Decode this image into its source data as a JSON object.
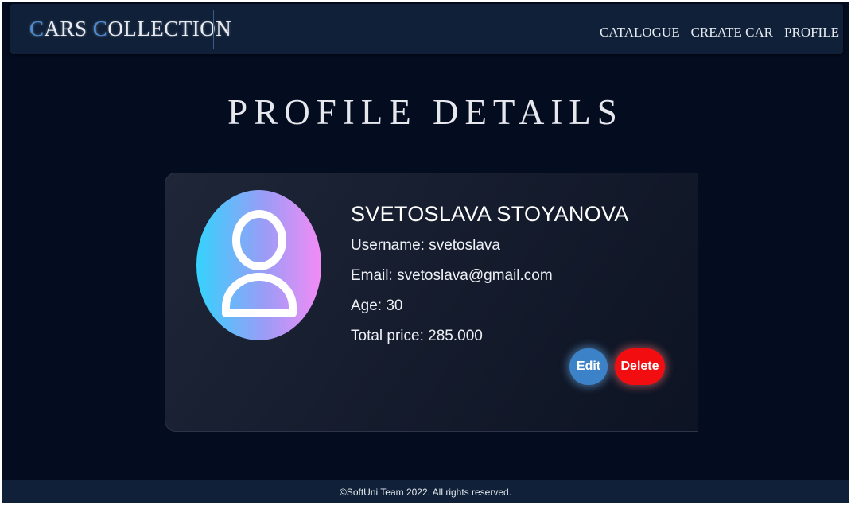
{
  "header": {
    "logo": {
      "first_cap": "C",
      "first_rest": "ARS",
      "second_cap": "C",
      "second_rest": "OLLECTION"
    },
    "nav": [
      "CATALOGUE",
      "CREATE CAR",
      "PROFILE"
    ]
  },
  "page": {
    "title": "PROFILE DETAILS"
  },
  "profile": {
    "full_name": "SVETOSLAVA STOYANOVA",
    "username_line": "Username: svetoslava",
    "email_line": "Email: svetoslava@gmail.com",
    "age_line": "Age: 30",
    "total_price_line": "Total price: 285.000",
    "avatar_icon": "user-icon"
  },
  "actions": {
    "edit_label": "Edit",
    "delete_label": "Delete"
  },
  "footer": {
    "text": "©SoftUni Team 2022. All rights reserved."
  },
  "colors": {
    "background": "#040c20",
    "navbar": "#0f2038",
    "accent": "#4d8ed8",
    "edit_button": "#3c82c8",
    "delete_button": "#f20d10"
  }
}
